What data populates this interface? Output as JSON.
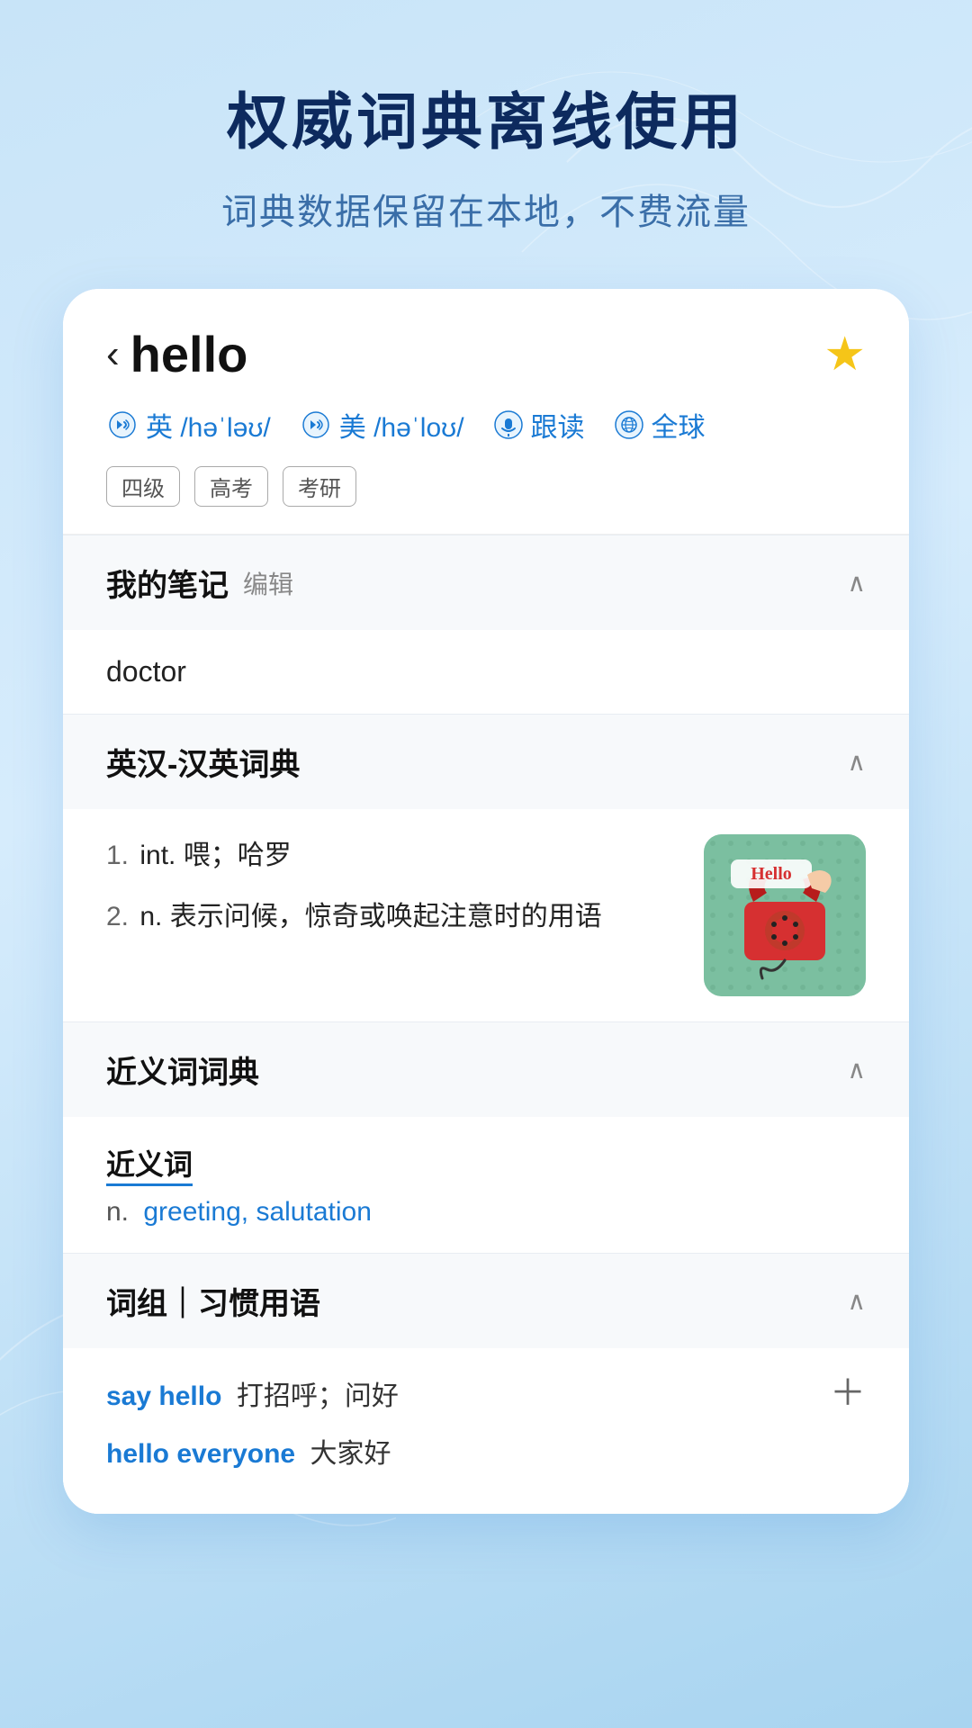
{
  "hero": {
    "title": "权威词典离线使用",
    "subtitle": "词典数据保留在本地，不费流量"
  },
  "word": {
    "back_label": "‹",
    "text": "hello",
    "star": "★",
    "pronunciations": [
      {
        "type": "英",
        "phonetic": "/həˈləʊ/"
      },
      {
        "type": "美",
        "phonetic": "/həˈloʊ/"
      }
    ],
    "follow_read": "跟读",
    "global": "全球",
    "tags": [
      "四级",
      "高考",
      "考研"
    ]
  },
  "sections": {
    "notes": {
      "title": "我的笔记",
      "edit_label": "编辑",
      "content": "doctor"
    },
    "dict": {
      "title": "英汉-汉英词典",
      "definitions": [
        {
          "num": "1.",
          "pos": "int.",
          "text": "喂；哈罗"
        },
        {
          "num": "2.",
          "pos": "n.",
          "text": "表示问候，惊奇或唤起注意时的用语"
        }
      ]
    },
    "synonym": {
      "title": "近义词词典",
      "section_label": "近义词",
      "type": "n.",
      "words": "greeting, salutation"
    },
    "phrases": {
      "title": "词组｜习惯用语",
      "items": [
        {
          "english": "say hello",
          "chinese": "打招呼；问好",
          "has_add": true
        },
        {
          "english": "hello everyone",
          "chinese": "大家好",
          "has_add": false
        }
      ]
    }
  }
}
